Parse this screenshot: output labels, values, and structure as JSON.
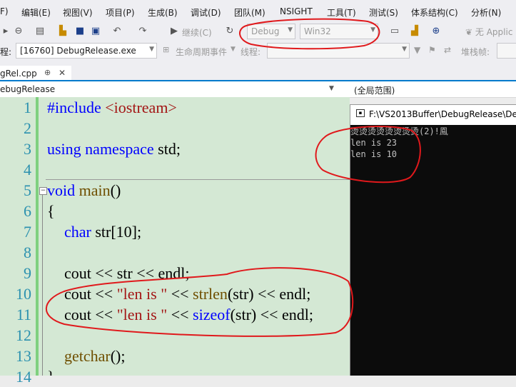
{
  "menu": [
    "F)",
    "编辑(E)",
    "视图(V)",
    "项目(P)",
    "生成(B)",
    "调试(D)",
    "团队(M)",
    "NSIGHT",
    "工具(T)",
    "测试(S)",
    "体系结构(C)",
    "分析(N)"
  ],
  "toolbar": {
    "continue_label": "继续(C)",
    "config": "Debug",
    "platform": "Win32",
    "app_insights": "无 Applic"
  },
  "debugbar": {
    "process_label": "程:",
    "process_value": "[16760] DebugRelease.exe",
    "lifecycle_label": "生命周期事件",
    "thread_label": "线程:",
    "stackframe_label": "堆栈帧:"
  },
  "tab": {
    "filename": "gRel.cpp",
    "pin": "⊕",
    "close": "✕"
  },
  "navbar": {
    "scope_left": "ebugRelease",
    "scope_right": "(全局范围)"
  },
  "code": {
    "line_numbers": [
      "1",
      "2",
      "3",
      "4",
      "5",
      "6",
      "7",
      "8",
      "9",
      "10",
      "11",
      "12",
      "13",
      "14"
    ],
    "l1_a": "#include ",
    "l1_b": "<iostream>",
    "l3_a": "using namespace ",
    "l3_b": "std;",
    "l5_a": "void ",
    "l5_b": "main",
    "l5_c": "()",
    "l6": "{",
    "l7_a": "char ",
    "l7_b": "str[10];",
    "l9": "cout << str << endl;",
    "l10_a": "cout << ",
    "l10_b": "\"len is \"",
    "l10_c": " << ",
    "l10_d": "strlen",
    "l10_e": "(str) << endl;",
    "l11_a": "cout << ",
    "l11_b": "\"len is \"",
    "l11_c": " << ",
    "l11_d": "sizeof",
    "l11_e": "(str) << endl;",
    "l13_a": "getchar",
    "l13_b": "();",
    "l14": "}"
  },
  "console": {
    "title": "F:\\VS2013Buffer\\DebugRelease\\De",
    "lines": [
      "烫烫烫烫烫烫烫烫(2)!鳯",
      "len is 23",
      "len is 10"
    ]
  },
  "colors": {
    "annotation": "#e0191c",
    "editor_bg": "#d4e8d4",
    "console_bg": "#0c0c0c"
  }
}
